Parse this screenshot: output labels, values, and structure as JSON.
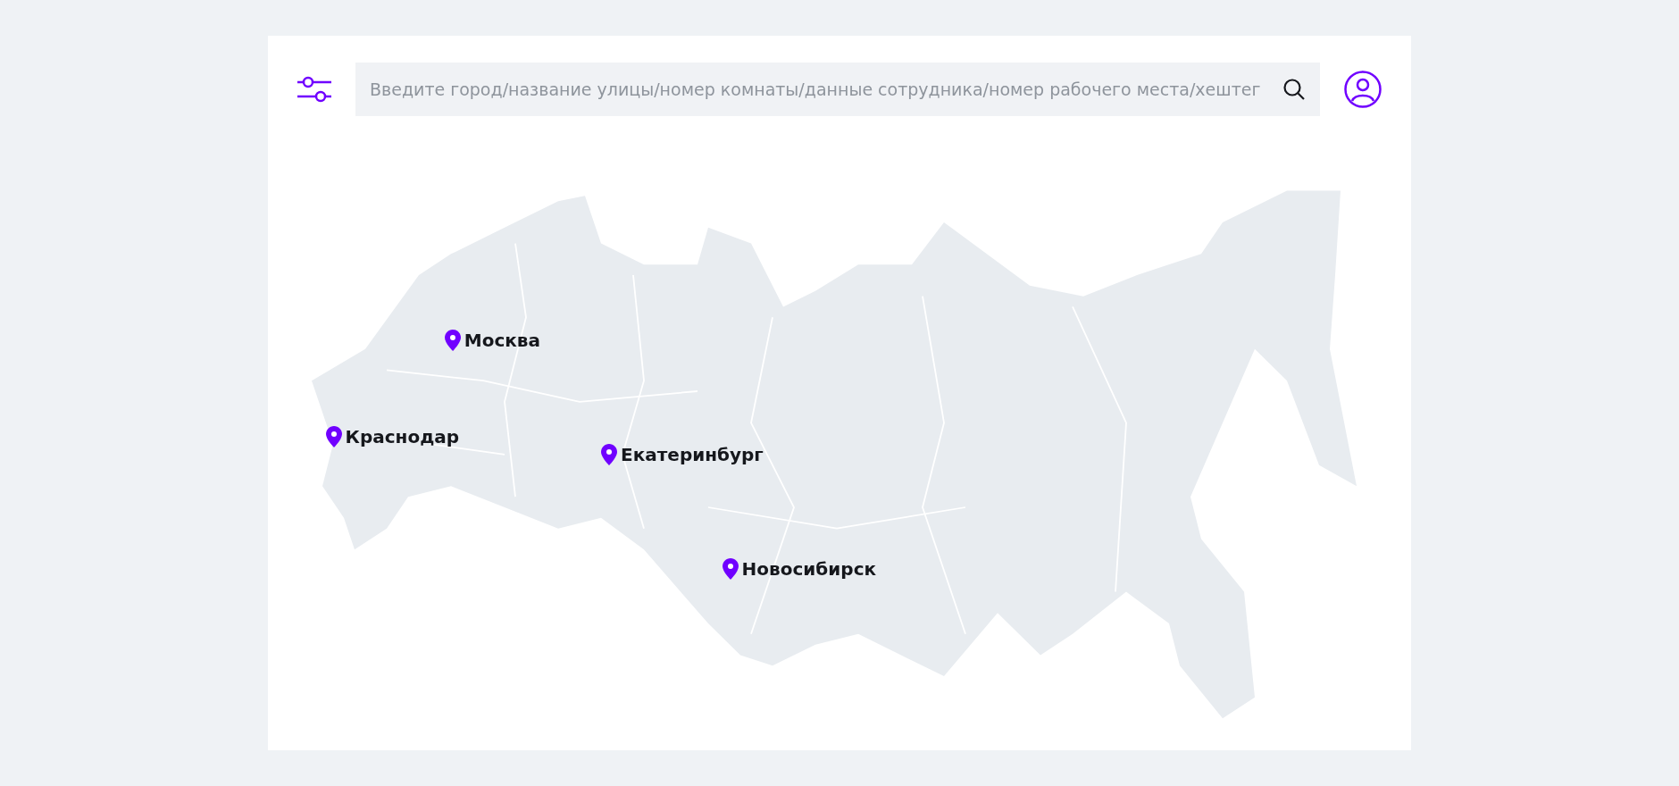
{
  "search": {
    "placeholder": "Введите город/название улицы/номер комнаты/данные сотрудника/номер рабочего места/хештег"
  },
  "map": {
    "cities": [
      {
        "name": "Москва"
      },
      {
        "name": "Краснодар"
      },
      {
        "name": "Екатеринбург"
      },
      {
        "name": "Новосибирск"
      }
    ]
  }
}
